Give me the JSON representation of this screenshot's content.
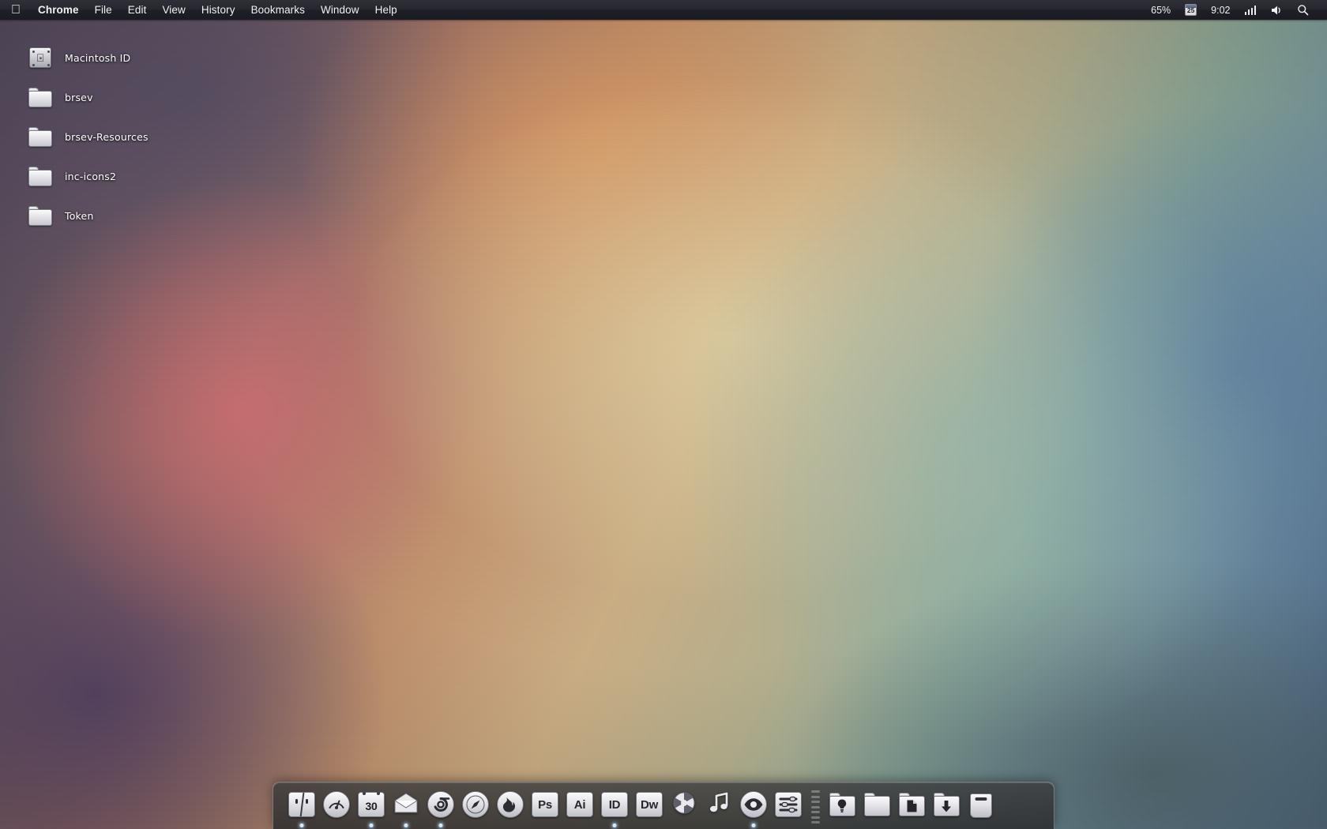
{
  "menubar": {
    "apple_icon": "apple-logo-icon",
    "items": [
      {
        "label": "Chrome",
        "bold": true
      },
      {
        "label": "File",
        "bold": false
      },
      {
        "label": "Edit",
        "bold": false
      },
      {
        "label": "View",
        "bold": false
      },
      {
        "label": "History",
        "bold": false
      },
      {
        "label": "Bookmarks",
        "bold": false
      },
      {
        "label": "Window",
        "bold": false
      },
      {
        "label": "Help",
        "bold": false
      }
    ],
    "status": {
      "battery": "65%",
      "calendar_day": "25",
      "time": "9:02",
      "wifi_icon": "wifi-signal-icon",
      "volume_icon": "volume-icon",
      "search_icon": "spotlight-search-icon"
    }
  },
  "desktop": {
    "icons": [
      {
        "label": "Macintosh ID",
        "type": "hard-drive"
      },
      {
        "label": "brsev",
        "type": "folder"
      },
      {
        "label": "brsev-Resources",
        "type": "folder"
      },
      {
        "label": "inc-icons2",
        "type": "folder"
      },
      {
        "label": "Token",
        "type": "folder"
      }
    ]
  },
  "dock": {
    "items": [
      {
        "name": "finder",
        "label": "Finder",
        "kind": "finder",
        "glyph": "",
        "running": true
      },
      {
        "name": "dashboard",
        "label": "Dashboard",
        "kind": "gauge",
        "glyph": "",
        "running": false
      },
      {
        "name": "calendar",
        "label": "Calendar",
        "kind": "calendar",
        "glyph": "30",
        "running": true
      },
      {
        "name": "mail",
        "label": "Mail",
        "kind": "mail",
        "glyph": "",
        "running": true
      },
      {
        "name": "chrome",
        "label": "Google Chrome",
        "kind": "chrome",
        "glyph": "",
        "running": true
      },
      {
        "name": "safari",
        "label": "Safari",
        "kind": "safari",
        "glyph": "",
        "running": false
      },
      {
        "name": "firefox",
        "label": "Firefox",
        "kind": "firefox",
        "glyph": "",
        "running": false
      },
      {
        "name": "photoshop",
        "label": "Photoshop",
        "kind": "tile",
        "glyph": "Ps",
        "running": false
      },
      {
        "name": "illustrator",
        "label": "Illustrator",
        "kind": "tile",
        "glyph": "Ai",
        "running": false
      },
      {
        "name": "indesign",
        "label": "InDesign",
        "kind": "tile",
        "glyph": "ID",
        "running": true
      },
      {
        "name": "dreamweaver",
        "label": "Dreamweaver",
        "kind": "tile",
        "glyph": "Dw",
        "running": false
      },
      {
        "name": "aperture",
        "label": "Aperture",
        "kind": "aperture",
        "glyph": "",
        "running": false
      },
      {
        "name": "itunes",
        "label": "iTunes",
        "kind": "music",
        "glyph": "",
        "running": false
      },
      {
        "name": "preview",
        "label": "Preview",
        "kind": "eye",
        "glyph": "",
        "running": true
      },
      {
        "name": "system-preferences",
        "label": "System Preferences",
        "kind": "sliders",
        "glyph": "",
        "running": false
      },
      {
        "name": "separator",
        "label": "Separator",
        "kind": "sep",
        "glyph": "",
        "running": false
      },
      {
        "name": "applications-folder",
        "label": "Applications",
        "kind": "folder",
        "glyph": "bulb",
        "running": false
      },
      {
        "name": "plain-folder",
        "label": "Folder",
        "kind": "folder",
        "glyph": "",
        "running": false
      },
      {
        "name": "documents-folder",
        "label": "Documents",
        "kind": "folder",
        "glyph": "doc",
        "running": false
      },
      {
        "name": "downloads-folder",
        "label": "Downloads",
        "kind": "folder",
        "glyph": "down",
        "running": false
      },
      {
        "name": "trash",
        "label": "Trash",
        "kind": "trash",
        "glyph": "",
        "running": false
      }
    ]
  }
}
